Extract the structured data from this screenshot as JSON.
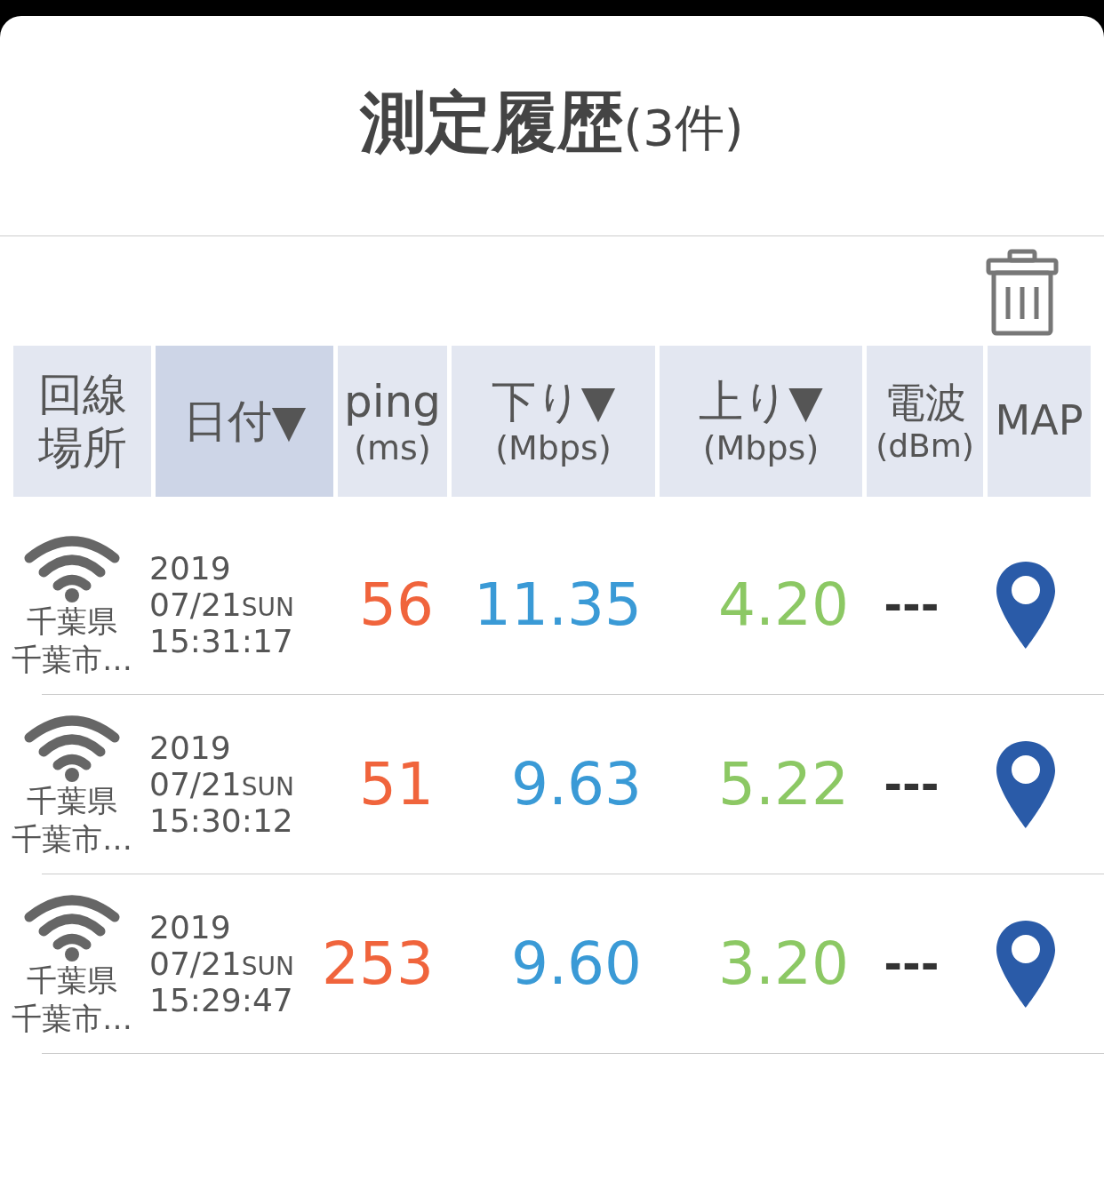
{
  "title": {
    "main": "測定履歴",
    "count": "(3件)"
  },
  "columns": [
    {
      "title": "回線場所",
      "selected": false
    },
    {
      "title": "日付▼",
      "selected": true
    },
    {
      "title": "ping",
      "unit": "(ms)",
      "selected": false
    },
    {
      "title": "下り▼",
      "unit": "(Mbps)",
      "selected": false
    },
    {
      "title": "上り▼",
      "unit": "(Mbps)",
      "selected": false
    },
    {
      "title": "電波",
      "unit": "(dBm)",
      "selected": false
    },
    {
      "title": "MAP",
      "selected": false
    }
  ],
  "rows": [
    {
      "kind": "wifi",
      "location": [
        "千葉県",
        "千葉市…"
      ],
      "year": "2019",
      "date": "07/21",
      "weekday": "SUN",
      "time": "15:31:17",
      "ping": "56",
      "download": "11.35",
      "upload": "4.20",
      "signal": "---"
    },
    {
      "kind": "wifi",
      "location": [
        "千葉県",
        "千葉市…"
      ],
      "year": "2019",
      "date": "07/21",
      "weekday": "SUN",
      "time": "15:30:12",
      "ping": "51",
      "download": "9.63",
      "upload": "5.22",
      "signal": "---"
    },
    {
      "kind": "wifi",
      "location": [
        "千葉県",
        "千葉市…"
      ],
      "year": "2019",
      "date": "07/21",
      "weekday": "SUN",
      "time": "15:29:47",
      "ping": "253",
      "download": "9.60",
      "upload": "3.20",
      "signal": "---"
    }
  ]
}
